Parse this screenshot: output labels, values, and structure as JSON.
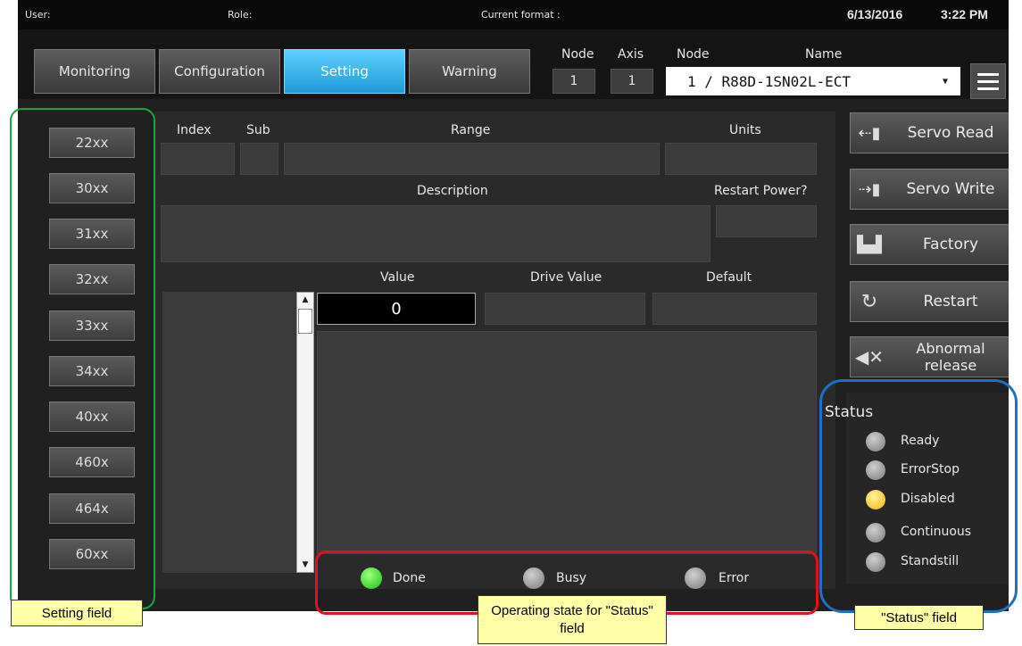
{
  "header": {
    "user_label": "User:",
    "role_label": "Role:",
    "format_label": "Current format :",
    "date": "6/13/2016",
    "time": "3:22 PM"
  },
  "tabs": [
    {
      "label": "Monitoring",
      "active": false
    },
    {
      "label": "Configuration",
      "active": false
    },
    {
      "label": "Setting",
      "active": true
    },
    {
      "label": "Warning",
      "active": false
    }
  ],
  "selector": {
    "node_label": "Node",
    "axis_label": "Axis",
    "node_value": "1",
    "axis_value": "1",
    "node_name_label": "Node",
    "name_label": "Name",
    "selected_node": "1  /  R88D-1SN02L-ECT"
  },
  "setting_buttons": [
    "22xx",
    "30xx",
    "31xx",
    "32xx",
    "33xx",
    "34xx",
    "40xx",
    "460x",
    "464x",
    "60xx"
  ],
  "panel": {
    "index_label": "Index",
    "sub_label": "Sub",
    "range_label": "Range",
    "units_label": "Units",
    "description_label": "Description",
    "restart_power_label": "Restart Power?",
    "value_label": "Value",
    "drive_value_label": "Drive Value",
    "default_label": "Default",
    "value": "0"
  },
  "operating_state": [
    {
      "label": "Done",
      "state": "on",
      "color": "#18c21a"
    },
    {
      "label": "Busy",
      "state": "off",
      "color": "#8a8a8a"
    },
    {
      "label": "Error",
      "state": "off",
      "color": "#8a8a8a"
    }
  ],
  "actions": [
    {
      "label": "Servo Read",
      "icon": "servo-read-icon"
    },
    {
      "label": "Servo Write",
      "icon": "servo-write-icon"
    },
    {
      "label": "Factory",
      "icon": "factory-icon"
    },
    {
      "label": "Restart",
      "icon": "restart-icon"
    },
    {
      "label": "Abnormal release",
      "icon": "mute-icon"
    }
  ],
  "status": {
    "title": "Status",
    "items": [
      {
        "label": "Ready",
        "state": "off"
      },
      {
        "label": "ErrorStop",
        "state": "off"
      },
      {
        "label": "Disabled",
        "state": "on",
        "color": "#f2b400"
      },
      {
        "label": "Continuous",
        "state": "off"
      },
      {
        "label": "Standstill",
        "state": "off"
      }
    ]
  },
  "annotations": {
    "setting_field": "Setting field",
    "operating_state": "Operating state for \"Status\" field",
    "status_field": "\"Status\" field",
    "colors": {
      "green": "#19a83a",
      "red": "#e0121b",
      "blue": "#1f6fc4"
    }
  }
}
